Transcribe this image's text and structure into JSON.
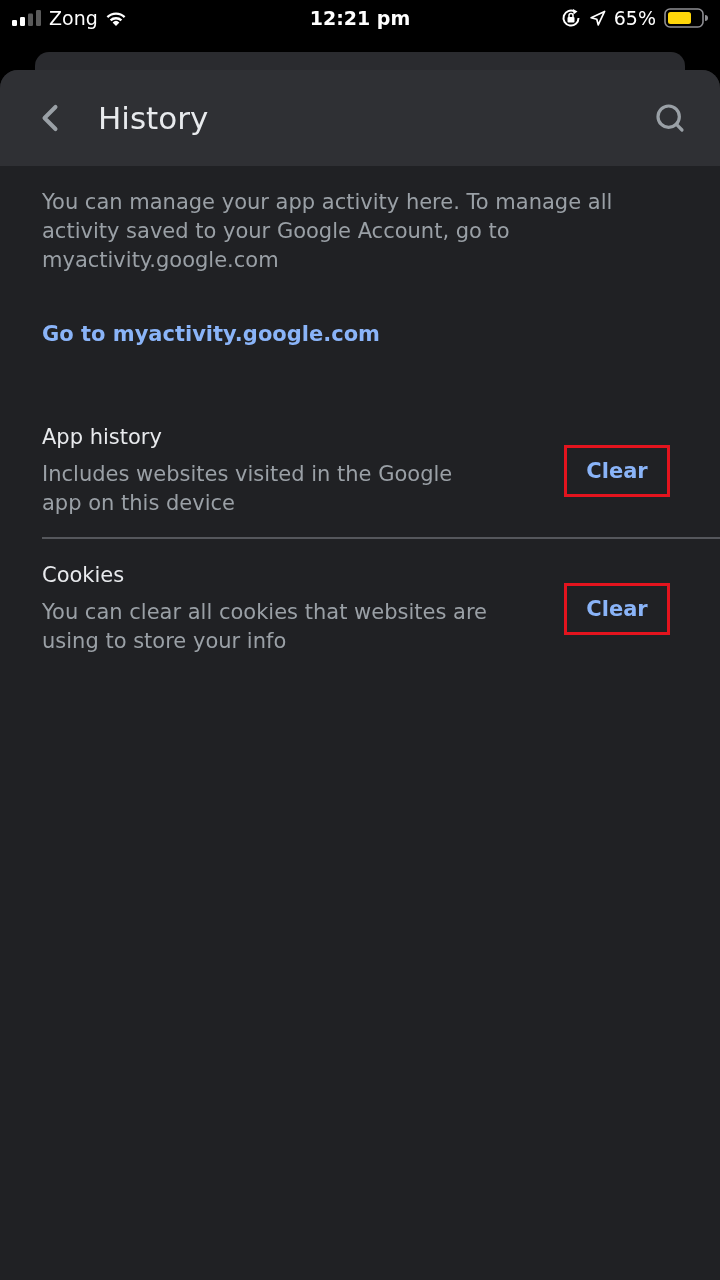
{
  "status_bar": {
    "carrier": "Zong",
    "time": "12:21 pm",
    "battery_percent": "65%"
  },
  "header": {
    "title": "History"
  },
  "intro": {
    "text": "You can manage your app activity here. To manage all activity saved to your Google Account, go to myactivity.google.com",
    "link": "Go to myactivity.google.com"
  },
  "sections": [
    {
      "title": "App history",
      "description": "Includes websites visited in the Google app on this device",
      "action": "Clear",
      "highlighted": true
    },
    {
      "title": "Cookies",
      "description": "You can clear all cookies that websites are using to store your info",
      "action": "Clear",
      "highlighted": true
    }
  ]
}
